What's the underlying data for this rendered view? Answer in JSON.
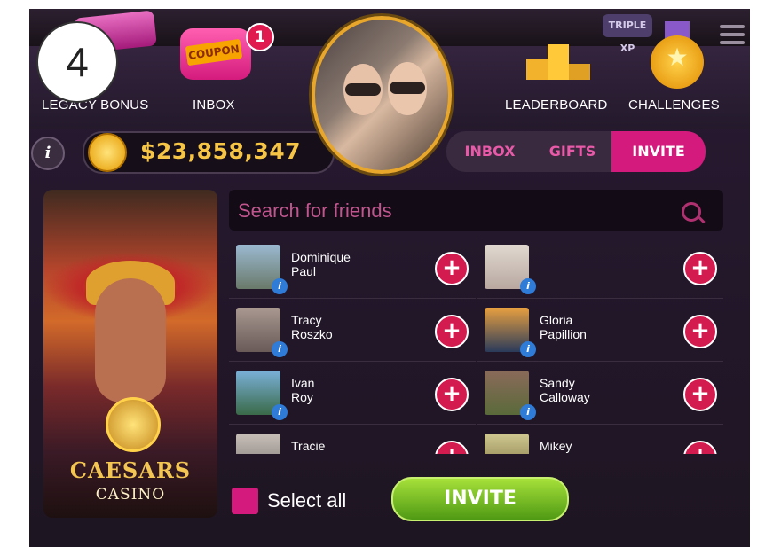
{
  "step_badge": "4",
  "top_nav": {
    "legacy_bonus": "LEGACY BONUS",
    "inbox": "INBOX",
    "leaderboard": "LEADERBOARD",
    "challenges": "CHALLENGES",
    "inbox_count": "1",
    "coupon_label": "COUPON",
    "triple_xp": "TRIPLE XP"
  },
  "balance": "$23,858,347",
  "tabs": [
    "INBOX",
    "GIFTS",
    "INVITE"
  ],
  "active_tab": "INVITE",
  "search": {
    "placeholder": "Search for friends"
  },
  "friends": [
    {
      "name": "Dominique\nPaul"
    },
    {
      "name": ""
    },
    {
      "name": "Tracy\nRoszko"
    },
    {
      "name": "Gloria\nPapillion"
    },
    {
      "name": "Ivan\nRoy"
    },
    {
      "name": "Sandy\nCalloway"
    },
    {
      "name": "Tracie"
    },
    {
      "name": "Mikey"
    }
  ],
  "promo": {
    "brand": "CAESARS",
    "sub": "CASINO"
  },
  "select_all_label": "Select all",
  "invite_button": "INVITE",
  "colors": {
    "accent": "#d41b7d",
    "balance": "#f7c545",
    "invite_green": "#6cb81e"
  }
}
